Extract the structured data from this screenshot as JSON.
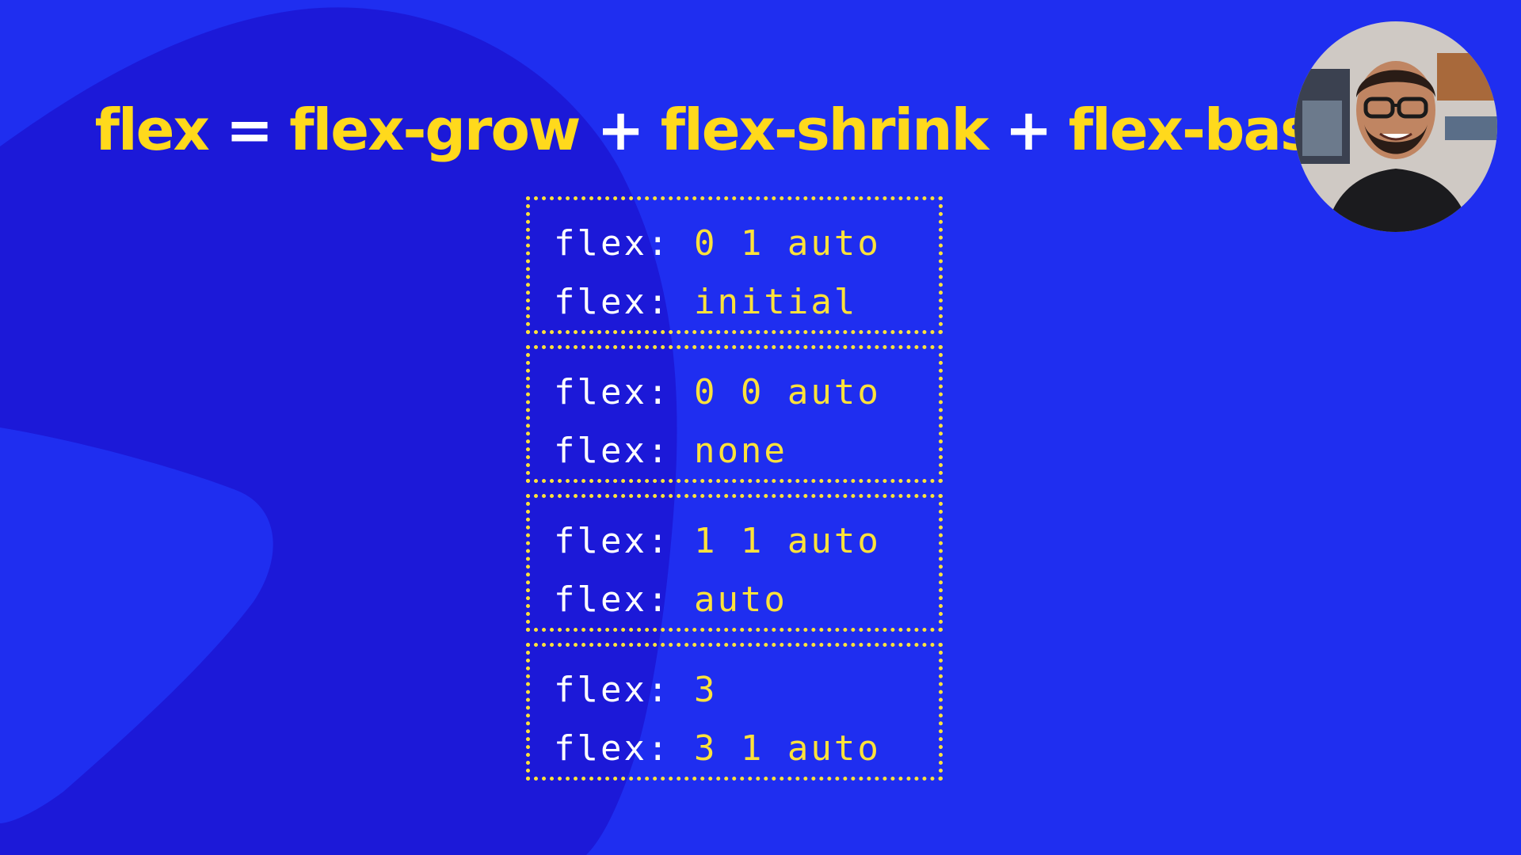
{
  "title": {
    "term_flex": "flex",
    "op_equals": "=",
    "term_grow": "flex-grow",
    "op_plus_1": "+",
    "term_shrink": "flex-shrink",
    "op_plus_2": "+",
    "term_basis": "flex-basis"
  },
  "boxes": [
    {
      "lines": [
        {
          "prop": "flex:",
          "value": "0 1 auto"
        },
        {
          "prop": "flex:",
          "value": "initial"
        }
      ]
    },
    {
      "lines": [
        {
          "prop": "flex:",
          "value": "0 0 auto"
        },
        {
          "prop": "flex:",
          "value": "none"
        }
      ]
    },
    {
      "lines": [
        {
          "prop": "flex:",
          "value": "1 1 auto"
        },
        {
          "prop": "flex:",
          "value": "auto"
        }
      ]
    },
    {
      "lines": [
        {
          "prop": "flex:",
          "value": "3"
        },
        {
          "prop": "flex:",
          "value": "3 1 auto"
        }
      ]
    }
  ],
  "colors": {
    "background": "#1f2ef0",
    "blob": "#1c19d8",
    "accent_yellow": "#ffd91c",
    "code_yellow": "#ffe23a",
    "white": "#ffffff"
  },
  "presenter": {
    "icon": "presenter-avatar-icon"
  }
}
